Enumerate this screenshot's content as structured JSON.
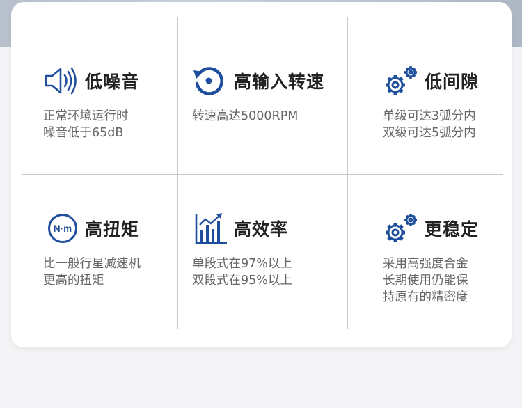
{
  "colors": {
    "accent": "#1f4f9c",
    "title": "#222222",
    "text": "#666666",
    "divider": "#c8c8c8"
  },
  "features": [
    {
      "icon": "speaker-icon",
      "title": "低噪音",
      "lines": [
        "正常环境运行时",
        "噪音低于65dB"
      ]
    },
    {
      "icon": "rotate-icon",
      "title": "高输入转速",
      "lines": [
        "转速高达5000RPM"
      ]
    },
    {
      "icon": "gears-icon",
      "title": "低间隙",
      "lines": [
        "单级可达3弧分内",
        "双级可达5弧分内"
      ]
    },
    {
      "icon": "torque-icon",
      "title": "高扭矩",
      "icon_text": "N·m",
      "lines": [
        "比一般行星减速机",
        "更高的扭矩"
      ]
    },
    {
      "icon": "bar-chart-icon",
      "title": "高效率",
      "lines": [
        "单段式在97%以上",
        "双段式在95%以上"
      ]
    },
    {
      "icon": "gears-icon",
      "title": "更稳定",
      "lines": [
        "采用高强度合金",
        "长期使用仍能保",
        "持原有的精密度"
      ]
    }
  ]
}
